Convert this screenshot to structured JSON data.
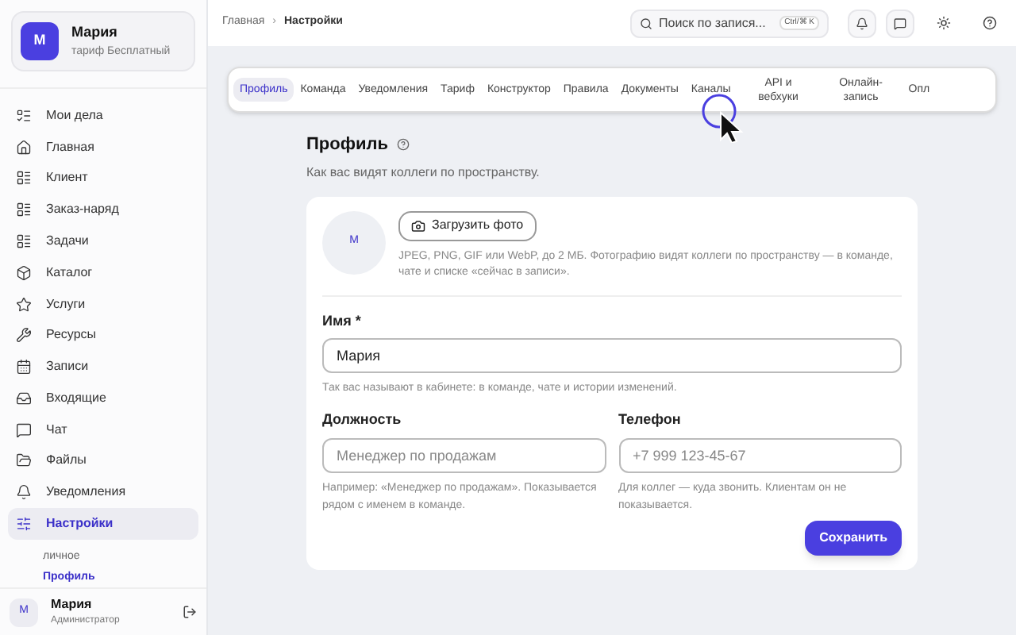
{
  "workspace": {
    "avatar": "М",
    "name": "Мария",
    "plan": "тариф Бесплатный"
  },
  "sidebar": {
    "items": [
      {
        "kind": "todo",
        "label": "Мои дела",
        "selected": false
      },
      {
        "kind": "home",
        "label": "Главная",
        "selected": false
      },
      {
        "kind": "list",
        "label": "Клиент",
        "selected": false
      },
      {
        "kind": "list",
        "label": "Заказ-наряд",
        "selected": false
      },
      {
        "kind": "list",
        "label": "Задачи",
        "selected": false
      },
      {
        "kind": "box",
        "label": "Каталог",
        "selected": false
      },
      {
        "kind": "star",
        "label": "Услуги",
        "selected": false
      },
      {
        "kind": "wrench",
        "label": "Ресурсы",
        "selected": false
      },
      {
        "kind": "calendar",
        "label": "Записи",
        "selected": false
      },
      {
        "kind": "inbox",
        "label": "Входящие",
        "selected": false
      },
      {
        "kind": "chat",
        "label": "Чат",
        "selected": false
      },
      {
        "kind": "folder",
        "label": "Файлы",
        "selected": false
      },
      {
        "kind": "bell",
        "label": "Уведомления",
        "selected": false
      },
      {
        "kind": "settings",
        "label": "Настройки",
        "selected": true
      }
    ],
    "sub_heading": "личное",
    "sub_items": [
      {
        "label": "Профиль",
        "selected": true
      }
    ]
  },
  "user": {
    "avatar": "М",
    "name": "Мария",
    "role": "Администратор"
  },
  "breadcrumbs": [
    "Главная",
    "Настройки"
  ],
  "breadcrumb_separator": "›",
  "search": {
    "placeholder": "Поиск по запися...",
    "shortcut": "Ctrl/⌘ K"
  },
  "tabs": [
    {
      "label": "Профиль",
      "selected": true
    },
    {
      "label": "Команда",
      "selected": false
    },
    {
      "label": "Уведомления",
      "selected": false
    },
    {
      "label": "Тариф",
      "selected": false
    },
    {
      "label": "Конструктор",
      "selected": false
    },
    {
      "label": "Правила",
      "selected": false
    },
    {
      "label": "Документы",
      "selected": false
    },
    {
      "label": "Каналы",
      "selected": false
    },
    {
      "label": "API и вебхуки",
      "selected": false
    },
    {
      "label": "Онлайн-запись",
      "selected": false
    },
    {
      "label": "Опл",
      "selected": false
    }
  ],
  "page": {
    "title": "Профиль",
    "subtitle": "Как вас видят коллеги по пространству."
  },
  "photo": {
    "avatar": "М",
    "button": "Загрузить фото",
    "hint": "JPEG, PNG, GIF или WebP, до 2 МБ. Фотографию видят коллеги по пространству — в команде, чате и списке «сейчас в записи»."
  },
  "fields": [
    {
      "label": "Имя *",
      "value": "Мария",
      "hint": "Так вас называют в кабинете: в команде, чате и истории изменений."
    },
    {
      "label": "Должность",
      "placeholder": "Менеджер по продажам",
      "hint": "Например: «Менеджер по продажам». Показывается рядом с именем в команде."
    },
    {
      "label": "Телефон",
      "placeholder": "+7 999 123-45-67",
      "hint": "Для коллег — куда звонить. Клиентам он не показывается."
    }
  ],
  "save_button": "Сохранить"
}
